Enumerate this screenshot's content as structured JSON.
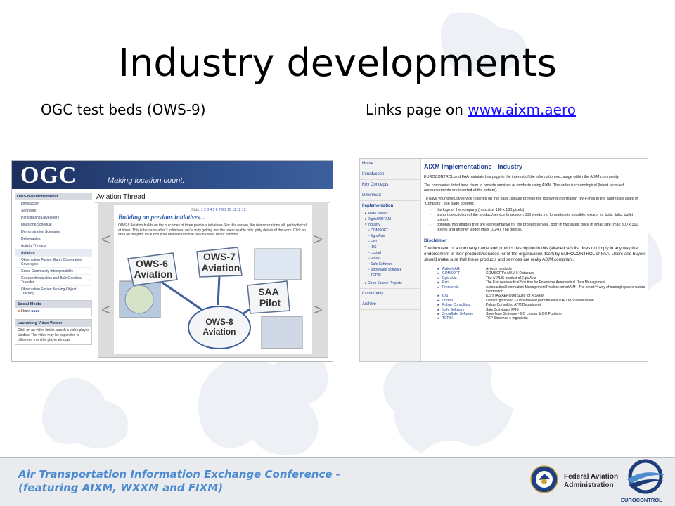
{
  "slide": {
    "title": "Industry developments",
    "left_caption": "OGC test beds  (OWS-9)",
    "right_caption_prefix": "Links page on ",
    "right_caption_link": "www.aixm.aero"
  },
  "ogc_page": {
    "logo": "OGC",
    "tagline": "Making location count.",
    "sidebar_heading": "OWS-8 Demonstration",
    "sidebar_items": [
      "Introduction",
      "Sponsors",
      "Participating Developers",
      "Milestone Schedule",
      "Demonstration Scenarios",
      "Deliverables",
      "Activity Threads",
      "Aviation",
      "Observation Fusion: Earth Observation Coverages",
      "Cross-Community Interoperability",
      "Geosynchronization and Bulk Geodata Transfer",
      "Observation Fusion: Moving-Object Tracking"
    ],
    "social_heading": "Social Media",
    "share_label": "Share",
    "video_heading": "Launching Video Viewer",
    "video_text": "Click on an video link to launch a video player window. The video may be expanded to fullscreen from the player window.",
    "main_title": "Aviation Thread",
    "pages_label": "Slide:",
    "pages": "1 2 3 4 5 6 7 8 9 10 11 12 13",
    "slide_heading": "Building on previous initiatives...",
    "slide_text": "OWS-8 Aviation builds on the outcomes of three previous initiatives. For this reason, the demonstrations will get technical at times. This is because after 3 initiatives, we're truly getting into the unescapable nitty gritty details of the work. Click an area on diagram to launch prior demonstration in new browser tab or window.",
    "bubbles": {
      "ows6": "OWS-6\nAviation",
      "ows7": "OWS-7\nAviation",
      "saa": "SAA\nPilot",
      "ows8": "OWS-8\nAviation"
    }
  },
  "aixm_page": {
    "nav": {
      "home": "Home",
      "introduction": "Introduction",
      "key_concepts": "Key Concepts",
      "download": "Download",
      "implementation": "Implementation",
      "sub": [
        "AIXM Viewer",
        "Digital NOTAM",
        "Industry"
      ],
      "companies": [
        "COMSOFT",
        "Egis Avia",
        "Esri",
        "IDS",
        "Luciad",
        "Pulsar",
        "Safe Software",
        "Snowflake Software",
        "TCPSI"
      ],
      "open_source": "Open Source Projects",
      "community": "Community",
      "archive": "Archive"
    },
    "title": "AIXM Implementations - Industry",
    "p1": "EUROCONTROL and FAA maintain this page in the interest of the information exchange within the AIXM community.",
    "p2": "The companies listed here claim to provide services or products using AIXM. The order is chronological (latest received announcements are inserted at the bottom).",
    "p3": "To have your product/service inserted on this page, please provide the following information (by e-mail to the addresses listed in \"Contacts\", see page bottom):",
    "bullets": [
      "the logo of the company (max size 180 x 180 pixels);",
      "a short description of the product/service (maximum 500 words; no formatting is possible, except for bold, italic, bullet points);",
      "optional, two images that are representative for the product/service, both in two sizes: once in small size (max 300 x 300 pixels) and another larger (max 1024 x 768 pixels)."
    ],
    "disclaimer_title": "Disclaimer",
    "disclaimer": "The inclusion of a company name and product description in this (alfabetical!) list does not imply in any way the endorsement of their products/services (or of the organisation itself) by EUROCONTROL or FAA. Users and buyers should make sure that these products and services are really AIXM compliant.",
    "companies": [
      {
        "name": "Avitech AG",
        "desc": "Avitech products"
      },
      {
        "name": "COMSOFT",
        "desc": "COMSOFT's AIXM 5 Database"
      },
      {
        "name": "Egis Avia",
        "desc": "The ATALIS product of Egis Avia"
      },
      {
        "name": "Esri",
        "desc": "The Esri Aeronautical Solution for Enterprise Aeronautical Data Management"
      },
      {
        "name": "Frequentis",
        "desc": "Aeronautical Information Management Product: smartAIM - The smart™ way of managing aeronautical information"
      },
      {
        "name": "IDS",
        "desc": "IDS's IAS AERODB Suite for AIS/AIM"
      },
      {
        "name": "Luciad",
        "desc": "LuciadLightspeed – Unparalleled performance in AIXM 5 visualization"
      },
      {
        "name": "Pulsar Consulting",
        "desc": "Pulsar Consulting ATM Department"
      },
      {
        "name": "Safe Software",
        "desc": "Safe Software's FME"
      },
      {
        "name": "Snowflake Software",
        "desc": "Snowflake Software - GO Loader & GO Publisher"
      },
      {
        "name": "TCPSI",
        "desc": "TCP Sistemas e Ingeniería"
      }
    ]
  },
  "footer": {
    "conference_line1": "Air Transportation Information Exchange Conference -",
    "conference_line2": "(featuring AIXM, WXXM and FIXM)",
    "faa_line1": "Federal Aviation",
    "faa_line2": "Administration",
    "eurocontrol": "EUROCONTROL"
  }
}
